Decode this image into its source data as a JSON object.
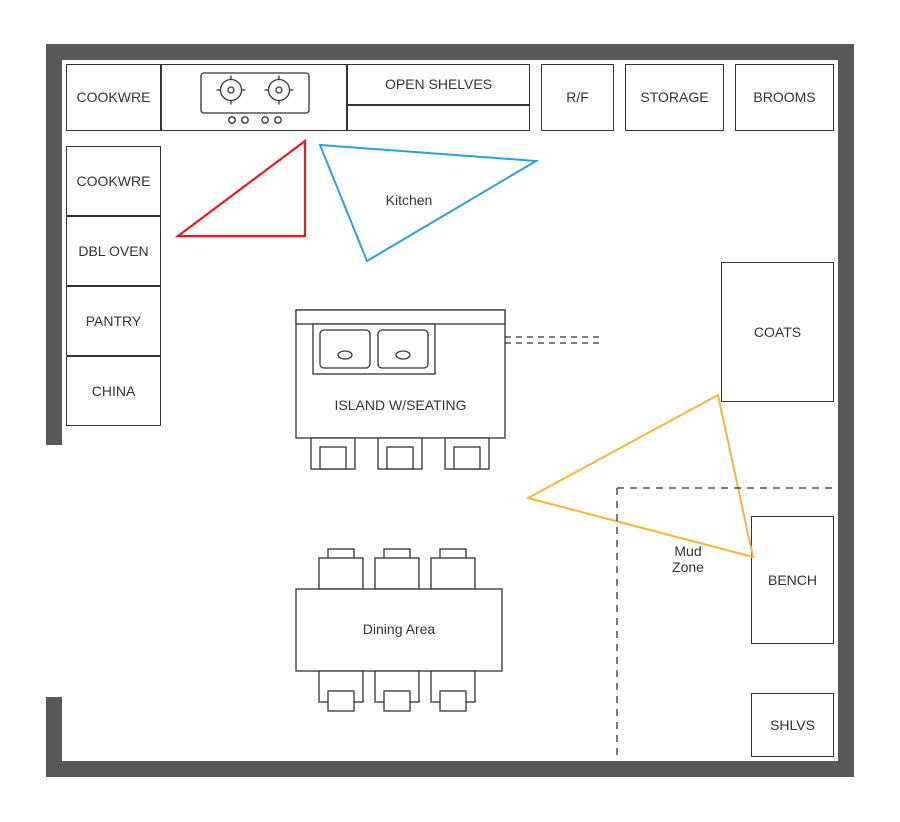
{
  "top_row": {
    "cookwre_top": "COOKWRE",
    "open_shelves": "OPEN SHELVES",
    "rf": "R/F",
    "storage": "STORAGE",
    "brooms": "BROOMS"
  },
  "left_col": {
    "cookwre_side": "COOKWRE",
    "dbl_oven": "DBL OVEN",
    "pantry": "PANTRY",
    "china": "CHINA"
  },
  "right_col": {
    "coats": "COATS",
    "bench": "BENCH",
    "shlvs": "SHLVS"
  },
  "island_label": "ISLAND W/SEATING",
  "dining_label": "Dining Area",
  "kitchen_label": "Kitchen",
  "mud_zone_line1": "Mud",
  "mud_zone_line2": "Zone",
  "colors": {
    "wall": "#585858",
    "red": "#E11D1D",
    "blue": "#2E9FD8",
    "orange": "#F5B43A",
    "line": "#333333"
  }
}
